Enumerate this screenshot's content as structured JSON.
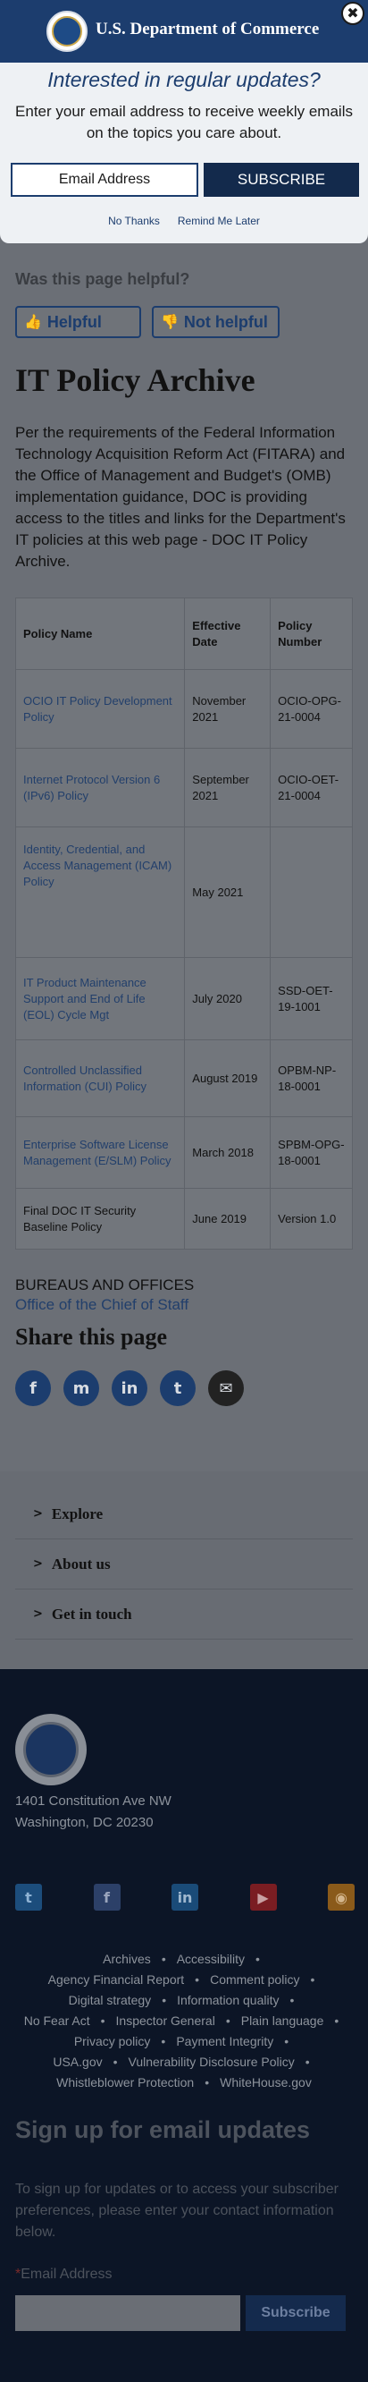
{
  "header": {
    "title": "U.S. Department of Commerce",
    "close_label": "✖"
  },
  "modal": {
    "title": "Interested in regular updates?",
    "text": "Enter your email address to receive weekly emails on the topics you care about.",
    "email_placeholder": "Email Address",
    "submit_label": "SUBSCRIBE",
    "no_thanks": "No Thanks",
    "remind_later": "Remind Me Later"
  },
  "feedback": {
    "question": "Was this page helpful?",
    "yes_label": "Helpful",
    "no_label": "Not helpful"
  },
  "page": {
    "title": "IT Policy Archive",
    "intro": "Per the requirements of the Federal Information Technology Acquisition Reform Act (FITARA) and the Office of Management and Budget's (OMB) implementation guidance, DOC is providing access to the titles and links for the Department's IT policies at this web page - DOC IT Policy Archive."
  },
  "table": {
    "headers": [
      "Policy Name",
      "Effective Date",
      "Policy Number"
    ],
    "rows": [
      {
        "name": "OCIO IT Policy Development Policy",
        "date": "November 2021",
        "number": "OCIO-OPG-21-0004",
        "link": true
      },
      {
        "name": "Internet Protocol Version 6 (IPv6) Policy",
        "date": "September 2021",
        "number": "OCIO-OET-21-0004",
        "link": true
      },
      {
        "name": "Identity, Credential, and Access Management (ICAM) Policy",
        "date": "May 2021",
        "number": "",
        "link": true
      },
      {
        "name": "IT Product Maintenance Support and End of Life (EOL) Cycle Mgt",
        "date": "July 2020",
        "number": "SSD-OET-19-1001",
        "link": true
      },
      {
        "name": "Controlled Unclassified Information (CUI) Policy",
        "date": "August 2019",
        "number": "OPBM-NP-18-0001",
        "link": true
      },
      {
        "name": "Enterprise Software License Management (E/SLM) Policy",
        "date": "March 2018",
        "number": "SPBM-OPG-18-0001",
        "link": true
      },
      {
        "name": "Final DOC IT Security Baseline Policy",
        "date": "June 2019",
        "number": "Version 1.0",
        "link": false
      }
    ]
  },
  "bureaus": {
    "heading": "BUREAUS AND OFFICES",
    "link": "Office of the Chief of Staff"
  },
  "share": {
    "title": "Share this page",
    "icons": [
      "f",
      "m",
      "in",
      "t",
      "✉"
    ]
  },
  "accordion": {
    "items": [
      "Explore",
      "About us",
      "Get in touch"
    ]
  },
  "footer": {
    "address_line1": "1401 Constitution Ave NW",
    "address_line2": "Washington, DC 20230",
    "social": [
      "t",
      "f",
      "in",
      "▶",
      "◉"
    ],
    "links_rows": [
      [
        "Archives",
        "Accessibility"
      ],
      [
        "Agency Financial Report",
        "Comment policy"
      ],
      [
        "Digital strategy",
        "Information quality"
      ],
      [
        "No Fear Act",
        "Inspector General",
        "Plain language"
      ],
      [
        "Privacy policy",
        "Payment Integrity"
      ],
      [
        "USA.gov",
        "Vulnerability Disclosure Policy"
      ],
      [
        "Whistleblower Protection",
        "WhiteHouse.gov"
      ]
    ],
    "signup_title": "Sign up for email updates",
    "signup_text": "To sign up for updates or to access your subscriber preferences, please enter your contact information below.",
    "email_label": "Email Address",
    "required_mark": "*",
    "submit_label": "Subscribe"
  }
}
